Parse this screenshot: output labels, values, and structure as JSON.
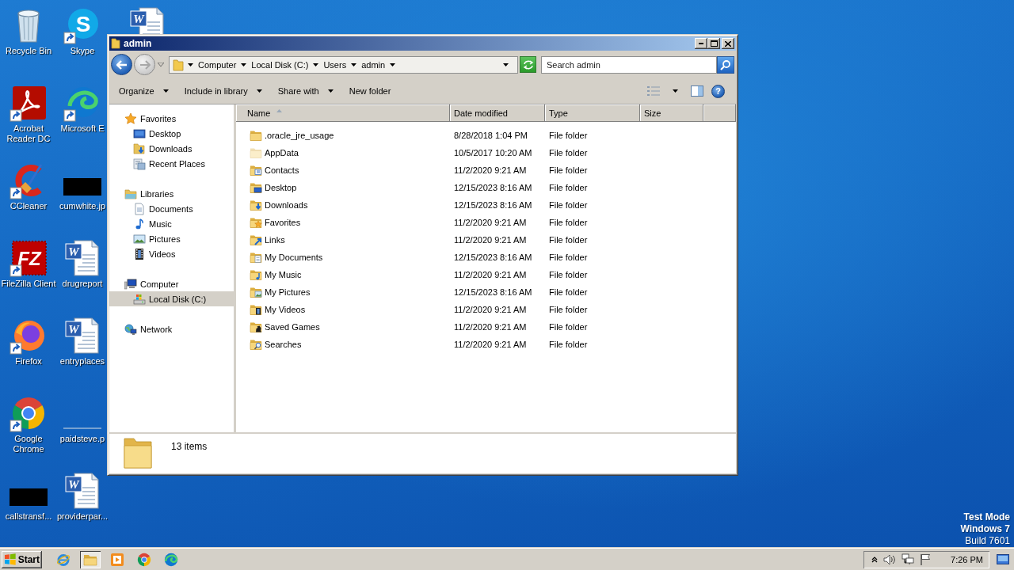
{
  "desktop": {
    "columns": [
      {
        "icons": [
          {
            "label": "Recycle Bin",
            "kind": "recycle-bin",
            "shortcut": false
          },
          {
            "label": "Acrobat Reader DC",
            "kind": "acrobat",
            "shortcut": true
          },
          {
            "label": "CCleaner",
            "kind": "ccleaner",
            "shortcut": true
          },
          {
            "label": "FileZilla Client",
            "kind": "filezilla",
            "glyph": "FZ",
            "shortcut": true
          },
          {
            "label": "Firefox",
            "kind": "firefox",
            "shortcut": true
          },
          {
            "label": "Google Chrome",
            "kind": "chrome",
            "shortcut": true
          },
          {
            "label": "callstransf...",
            "kind": "black-image",
            "shortcut": false
          }
        ]
      },
      {
        "icons": [
          {
            "label": "Skype",
            "kind": "skype",
            "glyph": "S",
            "shortcut": true
          },
          {
            "label": "Microsoft E",
            "kind": "edge",
            "shortcut": true
          },
          {
            "label": "cumwhite.jp",
            "kind": "black-image",
            "shortcut": false
          },
          {
            "label": "drugreport",
            "kind": "word-doc",
            "glyph": "W",
            "shortcut": false
          },
          {
            "label": "entryplaces",
            "kind": "word-doc",
            "glyph": "W",
            "shortcut": false
          },
          {
            "label": "paidsteve.p",
            "kind": "line-image",
            "shortcut": false
          },
          {
            "label": "providerpar...",
            "kind": "word-doc",
            "glyph": "W",
            "shortcut": false
          }
        ]
      },
      {
        "icons": [
          {
            "kind": "word-doc",
            "glyph": "W",
            "shortcut": false
          }
        ]
      }
    ]
  },
  "notice": [
    {
      "text": "Test Mode",
      "bold": true
    },
    {
      "text": "Windows 7",
      "bold": true
    },
    {
      "text": "Build 7601",
      "bold": false
    }
  ],
  "window": {
    "title": "admin",
    "address": {
      "crumbs": [
        "Computer",
        "Local Disk (C:)",
        "Users",
        "admin"
      ]
    },
    "search": {
      "placeholder": "Search admin"
    },
    "toolbar": {
      "buttons": [
        {
          "label": "Organize",
          "dropdown": true
        },
        {
          "label": "Include in library",
          "dropdown": true
        },
        {
          "label": "Share with",
          "dropdown": true
        },
        {
          "label": "New folder",
          "dropdown": false
        }
      ],
      "help_glyph": "?"
    },
    "nav": [
      {
        "label": "Favorites",
        "kind": "favorites",
        "selected": false,
        "children": [
          {
            "label": "Desktop",
            "kind": "desktop",
            "selected": false
          },
          {
            "label": "Downloads",
            "kind": "downloads",
            "selected": false
          },
          {
            "label": "Recent Places",
            "kind": "recent",
            "selected": false
          }
        ]
      },
      {
        "label": "Libraries",
        "kind": "libraries",
        "selected": false,
        "children": [
          {
            "label": "Documents",
            "kind": "documents",
            "selected": false
          },
          {
            "label": "Music",
            "kind": "music",
            "selected": false
          },
          {
            "label": "Pictures",
            "kind": "pictures",
            "selected": false
          },
          {
            "label": "Videos",
            "kind": "videos",
            "selected": false
          }
        ]
      },
      {
        "label": "Computer",
        "kind": "computer",
        "selected": false,
        "children": [
          {
            "label": "Local Disk (C:)",
            "kind": "disk",
            "selected": true
          }
        ]
      },
      {
        "label": "Network",
        "kind": "network",
        "selected": false
      }
    ],
    "files": {
      "columns": [
        {
          "label": "Name",
          "sorted": true
        },
        {
          "label": "Date modified",
          "sorted": false
        },
        {
          "label": "Type",
          "sorted": false
        },
        {
          "label": "Size",
          "sorted": false
        }
      ],
      "rows": [
        {
          "name": ".oracle_jre_usage",
          "date": "8/28/2018 1:04 PM",
          "type": "File folder",
          "kind": "plain",
          "hidden": false
        },
        {
          "name": "AppData",
          "date": "10/5/2017 10:20 AM",
          "type": "File folder",
          "kind": "plain",
          "hidden": true
        },
        {
          "name": "Contacts",
          "date": "11/2/2020 9:21 AM",
          "type": "File folder",
          "kind": "contacts",
          "hidden": false
        },
        {
          "name": "Desktop",
          "date": "12/15/2023 8:16 AM",
          "type": "File folder",
          "kind": "desktop",
          "hidden": false
        },
        {
          "name": "Downloads",
          "date": "12/15/2023 8:16 AM",
          "type": "File folder",
          "kind": "downloads",
          "hidden": false
        },
        {
          "name": "Favorites",
          "date": "11/2/2020 9:21 AM",
          "type": "File folder",
          "kind": "favorites",
          "hidden": false
        },
        {
          "name": "Links",
          "date": "11/2/2020 9:21 AM",
          "type": "File folder",
          "kind": "links",
          "hidden": false
        },
        {
          "name": "My Documents",
          "date": "12/15/2023 8:16 AM",
          "type": "File folder",
          "kind": "documents",
          "hidden": false
        },
        {
          "name": "My Music",
          "date": "11/2/2020 9:21 AM",
          "type": "File folder",
          "kind": "music",
          "hidden": false
        },
        {
          "name": "My Pictures",
          "date": "12/15/2023 8:16 AM",
          "type": "File folder",
          "kind": "pictures",
          "hidden": false
        },
        {
          "name": "My Videos",
          "date": "11/2/2020 9:21 AM",
          "type": "File folder",
          "kind": "videos",
          "hidden": false
        },
        {
          "name": "Saved Games",
          "date": "11/2/2020 9:21 AM",
          "type": "File folder",
          "kind": "games",
          "hidden": false
        },
        {
          "name": "Searches",
          "date": "11/2/2020 9:21 AM",
          "type": "File folder",
          "kind": "searches",
          "hidden": false
        }
      ]
    },
    "details": {
      "count": "13 items"
    }
  },
  "taskbar": {
    "start": "Start",
    "apps": [
      {
        "kind": "ie",
        "selected": false
      },
      {
        "kind": "explorer",
        "selected": true
      },
      {
        "kind": "media-player",
        "selected": false
      },
      {
        "kind": "chrome",
        "selected": false
      },
      {
        "kind": "edge",
        "selected": false
      }
    ],
    "clock": "7:26 PM"
  }
}
